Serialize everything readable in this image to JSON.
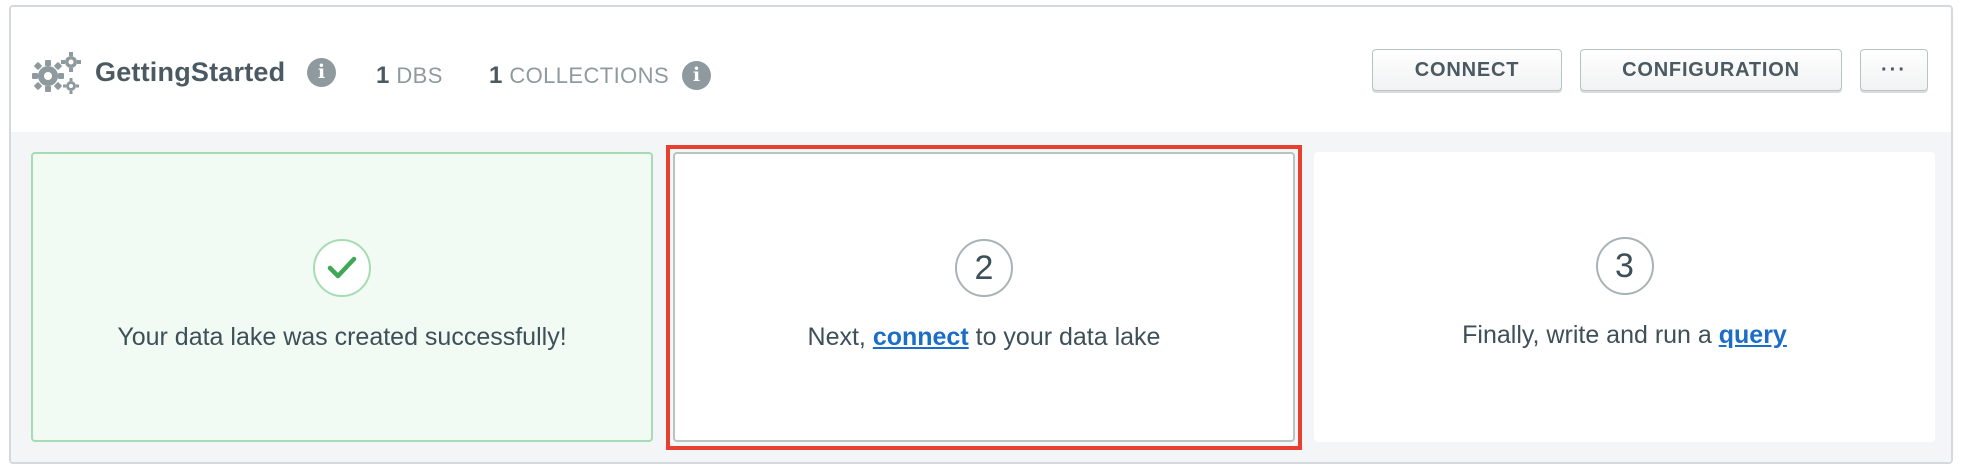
{
  "header": {
    "title": "GettingStarted",
    "stats": [
      {
        "value": "1",
        "label": "DBS"
      },
      {
        "value": "1",
        "label": "COLLECTIONS"
      }
    ],
    "buttons": {
      "connect": "CONNECT",
      "configuration": "CONFIGURATION",
      "more": "···"
    },
    "icons": {
      "cluster": "gears-icon",
      "info": "info-icon"
    }
  },
  "steps": [
    {
      "status": "complete",
      "icon": "checkmark-icon",
      "text": "Your data lake was created successfully!"
    },
    {
      "number": "2",
      "status": "current",
      "text_before": "Next, ",
      "link": "connect",
      "text_after": " to your data lake"
    },
    {
      "number": "3",
      "status": "pending",
      "text_before": "Finally, write and run a ",
      "link": "query",
      "text_after": ""
    }
  ],
  "colors": {
    "success_border": "#a6dcb4",
    "success_bg": "#f1faf3",
    "check": "#3fa856",
    "link": "#1a6ec8",
    "highlight": "#e8402e"
  }
}
